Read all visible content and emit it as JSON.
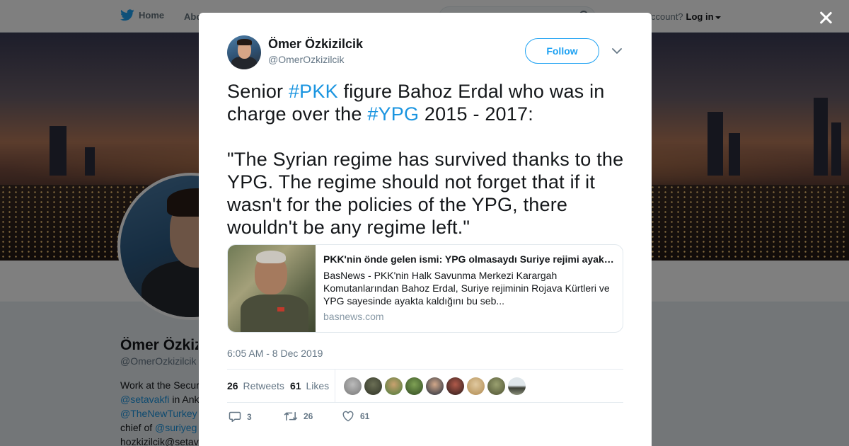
{
  "nav": {
    "home_label": "Home",
    "about_label": "Abo",
    "account_prompt": "ccount?",
    "login_label": "Log in"
  },
  "profile": {
    "name": "Ömer Özkiz",
    "handle": "@OmerOzkizilcik",
    "bio_lines": [
      {
        "text": "Work at the Secur",
        "link": ""
      },
      {
        "text": "",
        "link": "@setavakfi",
        "suffix": " in Ank"
      },
      {
        "text": "",
        "link": "@TheNewTurkey"
      },
      {
        "text": "chief of ",
        "link": "@suriyeg"
      },
      {
        "text": "hozkizilcik@setav",
        "link": ""
      }
    ]
  },
  "tweet": {
    "author_name": "Ömer Özkizilcik",
    "author_handle": "@OmerOzkizilcik",
    "follow_label": "Follow",
    "text_segments": [
      {
        "t": "Senior "
      },
      {
        "t": "#PKK",
        "hashtag": true
      },
      {
        "t": " figure Bahoz Erdal who was in charge over the "
      },
      {
        "t": "#YPG",
        "hashtag": true
      },
      {
        "t": " 2015 - 2017:\n\n\"The Syrian regime has survived thanks to the YPG. The regime should not forget that if it wasn't for the policies of the YPG, there wouldn't be any regime left.\""
      }
    ],
    "card": {
      "title": "PKK'nin önde gelen ismi: YPG olmasaydı Suriye rejimi ayakta kalamazdı",
      "description": "BasNews - PKK'nin Halk Savunma Merkezi Karargah Komutanlarından Bahoz Erdal, Suriye rejiminin Rojava Kürtleri ve YPG sayesinde ayakta kaldığını bu seb...",
      "domain": "basnews.com"
    },
    "timestamp": "6:05 AM - 8 Dec 2019",
    "retweets_count": "26",
    "retweets_label": "Retweets",
    "likes_count": "61",
    "likes_label": "Likes",
    "actions": {
      "reply_count": "3",
      "retweet_count": "26",
      "like_count": "61"
    }
  },
  "colors": {
    "accent": "#1da1f2",
    "hashtag": "#1b95e0",
    "muted": "#657786"
  }
}
